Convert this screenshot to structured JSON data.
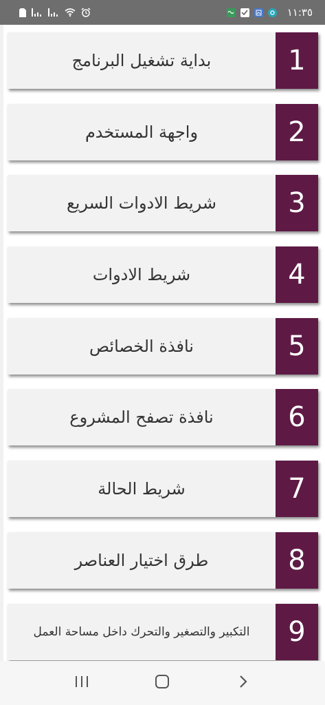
{
  "status_bar": {
    "time": "١١:٣٥",
    "icons_left": [
      "sim-card-icon",
      "signal-bars-icon",
      "signal-bars-icon",
      "wifi-icon",
      "alarm-icon"
    ],
    "icons_right": [
      "app-notification-icon",
      "check-box-icon",
      "app-notification-icon",
      "app-notification-icon"
    ],
    "background_color": "#6e6e6e"
  },
  "menu": {
    "accent_color": "#5e1a45",
    "items": [
      {
        "number": "1",
        "label": "بداية تشغيل البرنامج"
      },
      {
        "number": "2",
        "label": "واجهة المستخدم"
      },
      {
        "number": "3",
        "label": "شريط الادوات السريع"
      },
      {
        "number": "4",
        "label": "شريط الادوات"
      },
      {
        "number": "5",
        "label": "نافذة الخصائص"
      },
      {
        "number": "6",
        "label": "نافذة تصفح المشروع"
      },
      {
        "number": "7",
        "label": "شريط الحالة"
      },
      {
        "number": "8",
        "label": "طرق اختيار العناصر"
      },
      {
        "number": "9",
        "label": "التكبير والتصغير والتحرك داخل مساحة العمل"
      }
    ]
  },
  "nav_bar": {
    "buttons": [
      "recent-apps-icon",
      "home-icon",
      "back-icon"
    ]
  }
}
